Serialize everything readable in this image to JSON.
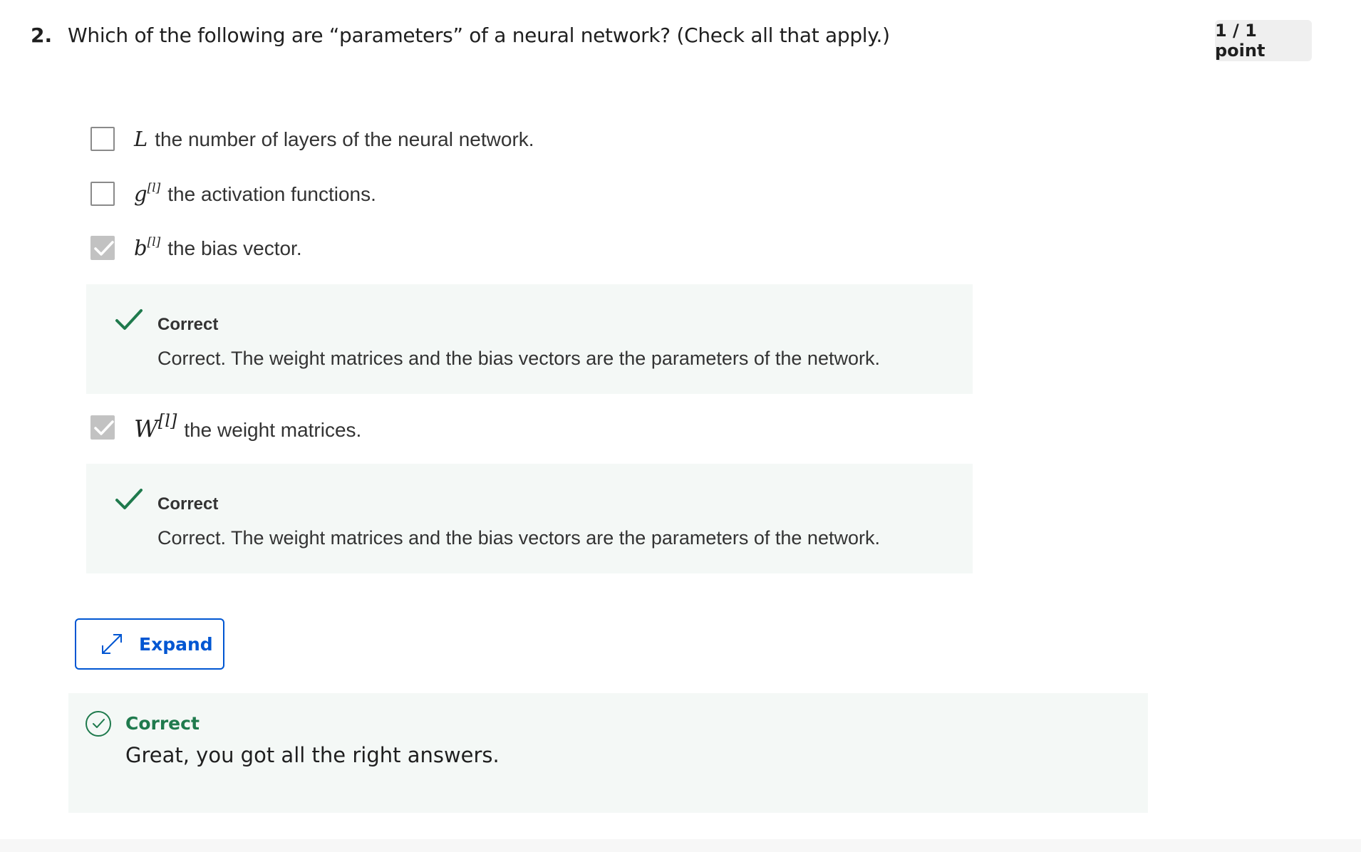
{
  "question": {
    "number": "2.",
    "text": "Which of the following are “parameters” of a neural network? (Check all that apply.)",
    "points": "1 / 1 point"
  },
  "options": [
    {
      "symbol": "L",
      "superscript": "",
      "description": "the number of layers of the neural network.",
      "checked": false
    },
    {
      "symbol": "g",
      "superscript": "[l]",
      "description": "the activation functions.",
      "checked": false
    },
    {
      "symbol": "b",
      "superscript": "[l]",
      "description": "the bias vector.",
      "checked": true
    },
    {
      "symbol": "W",
      "superscript": "[l]",
      "description": "the weight matrices.",
      "checked": true
    }
  ],
  "feedback": [
    {
      "title": "Correct",
      "body": "Correct. The weight matrices and the bias vectors are the parameters of the network."
    },
    {
      "title": "Correct",
      "body": "Correct. The weight matrices and the bias vectors are the parameters of the network."
    }
  ],
  "expand_button": {
    "label": "Expand",
    "icon": "expand-arrows-icon"
  },
  "result": {
    "title": "Correct",
    "body": "Great, you got all the right answers.",
    "icon": "check-circle-icon"
  },
  "colors": {
    "accent": "#0056d2",
    "success": "#1f7a4d",
    "feedback_bg": "#f4f8f6",
    "checkbox_checked": "#c2c2c2",
    "badge_bg": "#efefef"
  }
}
